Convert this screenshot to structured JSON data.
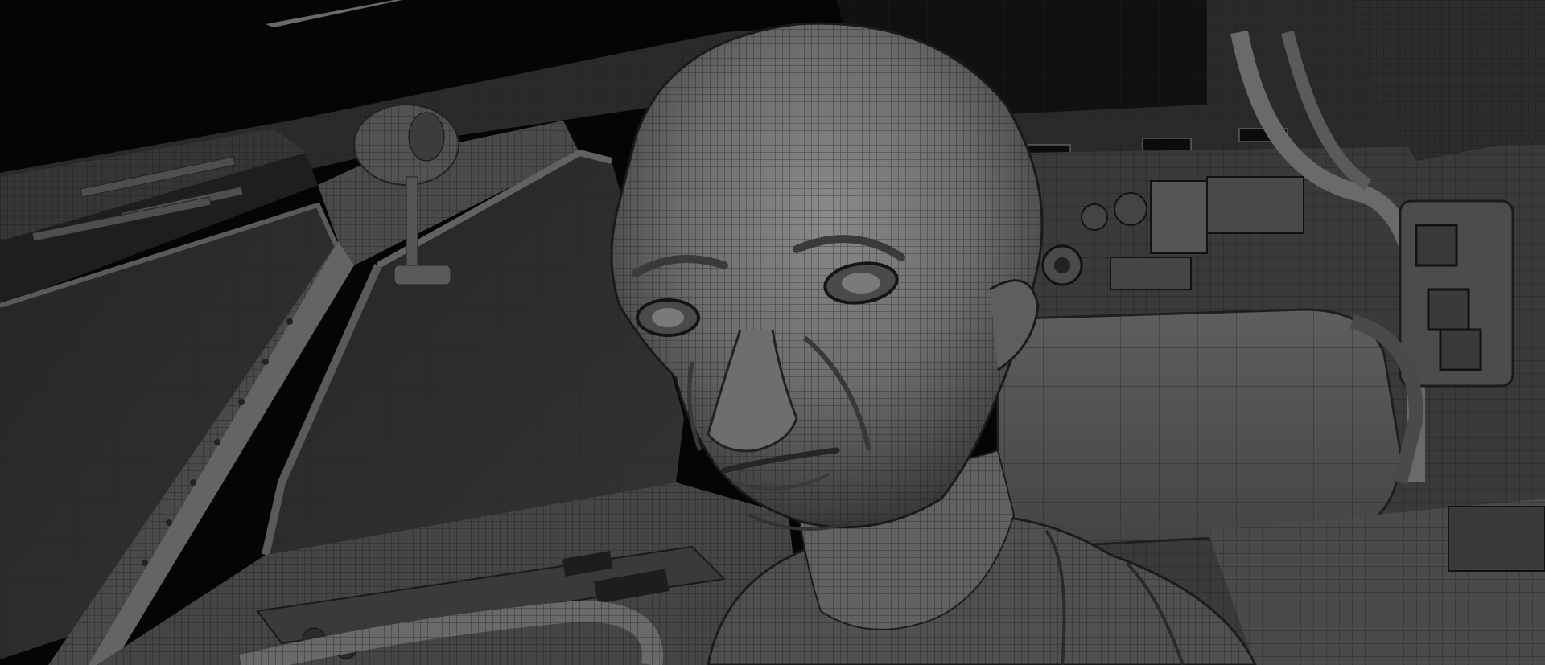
{
  "image": {
    "subject": "alien-pilot-wireframe-render",
    "palette": {
      "background": "#050505",
      "panel_dark": "#2a2a2a",
      "panel_mid": "#3f3f3f",
      "panel_light": "#5a5a5a",
      "wire": "#1a1a1a",
      "skin": "#6a6a6a",
      "window": "#303030"
    }
  }
}
